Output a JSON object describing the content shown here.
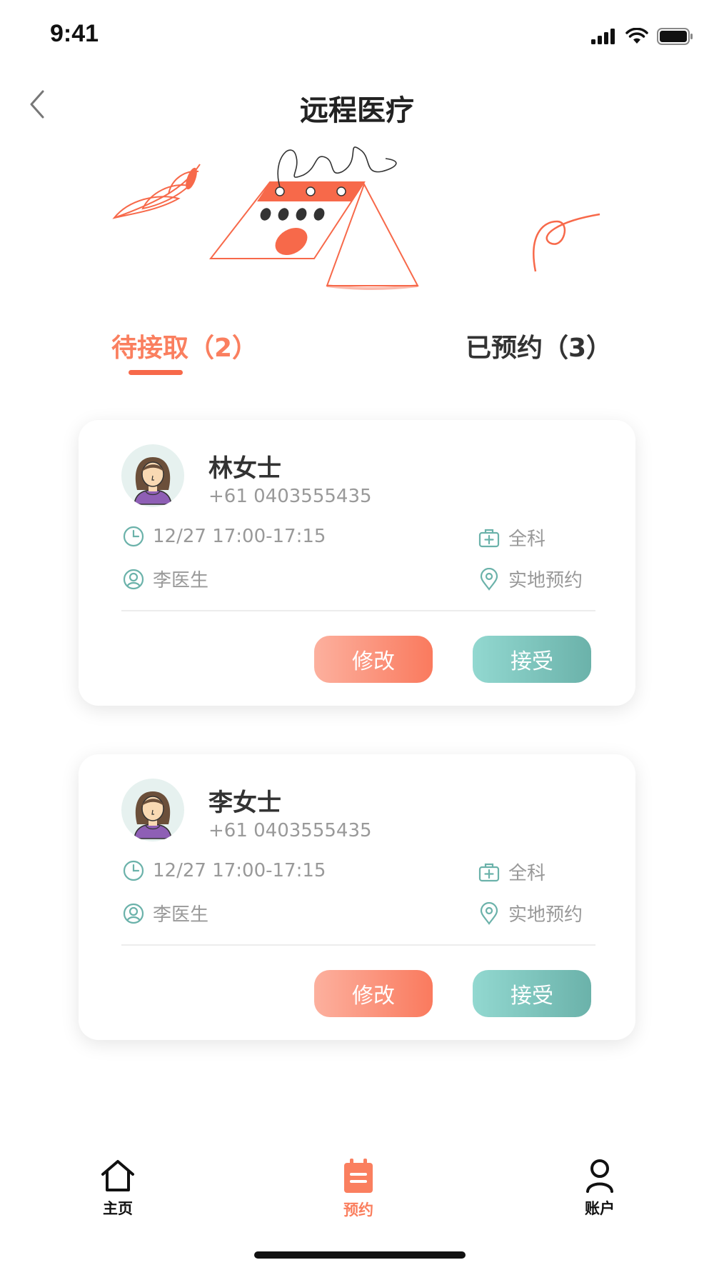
{
  "status_bar": {
    "time": "9:41"
  },
  "header": {
    "title": "远程医疗"
  },
  "tabs": [
    {
      "label": "待接取（2）",
      "active": true
    },
    {
      "label": "已预约（3）",
      "active": false
    }
  ],
  "appointments": [
    {
      "name": "林女士",
      "phone": "+61 0403555435",
      "time": "12/27 17:00-17:15",
      "department": "全科",
      "doctor": "李医生",
      "visit_type": "实地预约",
      "modify_label": "修改",
      "accept_label": "接受"
    },
    {
      "name": "李女士",
      "phone": "+61 0403555435",
      "time": "12/27 17:00-17:15",
      "department": "全科",
      "doctor": "李医生",
      "visit_type": "实地预约",
      "modify_label": "修改",
      "accept_label": "接受"
    }
  ],
  "bottom_nav": {
    "items": [
      {
        "label": "主页",
        "icon": "home-icon",
        "active": false
      },
      {
        "label": "预约",
        "icon": "calendar-icon",
        "active": true
      },
      {
        "label": "账户",
        "icon": "user-icon",
        "active": false
      }
    ]
  },
  "colors": {
    "accent_orange": "#fa7f5f",
    "accent_teal": "#6bb2aa",
    "text_primary": "#333333",
    "text_secondary": "#999999"
  }
}
